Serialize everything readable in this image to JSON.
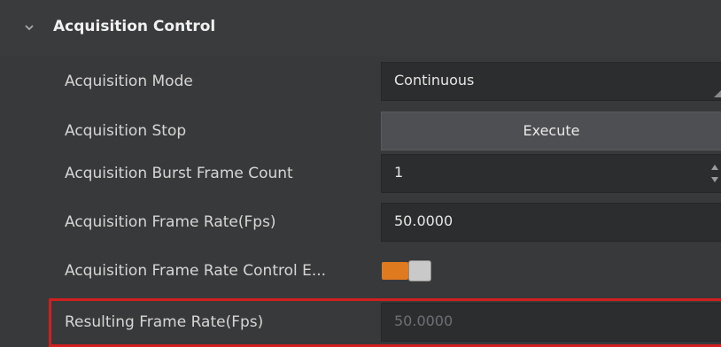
{
  "section": {
    "title": "Acquisition Control",
    "expand_icon": "chevron-down-icon"
  },
  "rows": {
    "acquisition_mode": {
      "label": "Acquisition Mode",
      "value": "Continuous"
    },
    "acquisition_stop": {
      "label": "Acquisition Stop",
      "button_label": "Execute"
    },
    "burst_frame_count": {
      "label": "Acquisition Burst Frame Count",
      "value": "1"
    },
    "frame_rate": {
      "label": "Acquisition Frame Rate(Fps)",
      "value": "50.0000"
    },
    "frame_rate_control": {
      "label": "Acquisition Frame Rate Control E...",
      "enabled": true
    },
    "resulting_frame_rate": {
      "label": "Resulting Frame Rate(Fps)",
      "value": "50.0000",
      "highlighted": true
    }
  },
  "colors": {
    "background": "#38393b",
    "field_background": "#2c2d2f",
    "toggle_on": "#e07a1f",
    "highlight_border": "#d21f1f"
  }
}
